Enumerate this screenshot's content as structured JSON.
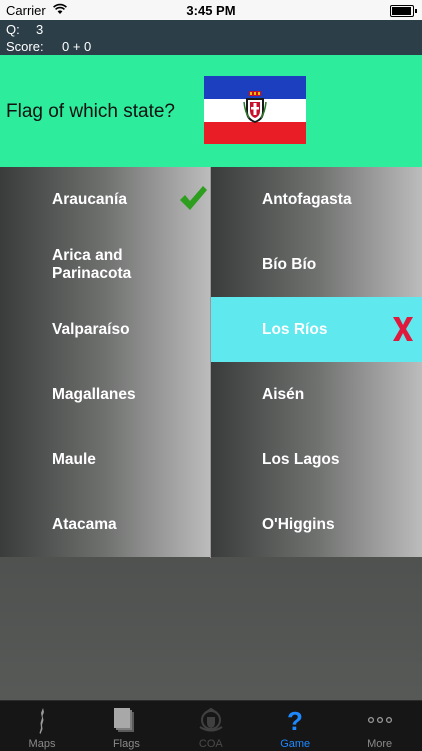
{
  "status": {
    "carrier": "Carrier",
    "time": "3:45 PM",
    "battery_level": 0.95
  },
  "info": {
    "q_label": "Q:",
    "q_value": "3",
    "score_label": "Score:",
    "score_value": "0 + 0"
  },
  "question": {
    "prompt": "Flag of which state?"
  },
  "flag": {
    "colors": {
      "top": "#1b3fbf",
      "middle": "#ffffff",
      "bottom": "#e81d25"
    },
    "icon": "coat-of-arms-icon"
  },
  "options": {
    "left": [
      "Araucanía",
      "Arica and Parinacota",
      "Valparaíso",
      "Magallanes",
      "Maule",
      "Atacama"
    ],
    "right": [
      "Antofagasta",
      "Bío Bío",
      "Los Ríos",
      "Aisén",
      "Los Lagos",
      "O'Higgins"
    ]
  },
  "marks": {
    "correct": "Araucanía",
    "wrong": "Los Ríos",
    "correct_color": "#2e9e1e",
    "wrong_color": "#e01a3c"
  },
  "tabs": [
    {
      "label": "Maps",
      "icon": "map-icon"
    },
    {
      "label": "Flags",
      "icon": "flags-icon"
    },
    {
      "label": "COA",
      "icon": "coat-of-arms-icon"
    },
    {
      "label": "Game",
      "icon": "question-icon"
    },
    {
      "label": "More",
      "icon": "more-icon"
    }
  ],
  "colors": {
    "accent": "#1e88ff",
    "question_bg": "#2ded9c",
    "selected_bg": "#5fe8ee"
  }
}
